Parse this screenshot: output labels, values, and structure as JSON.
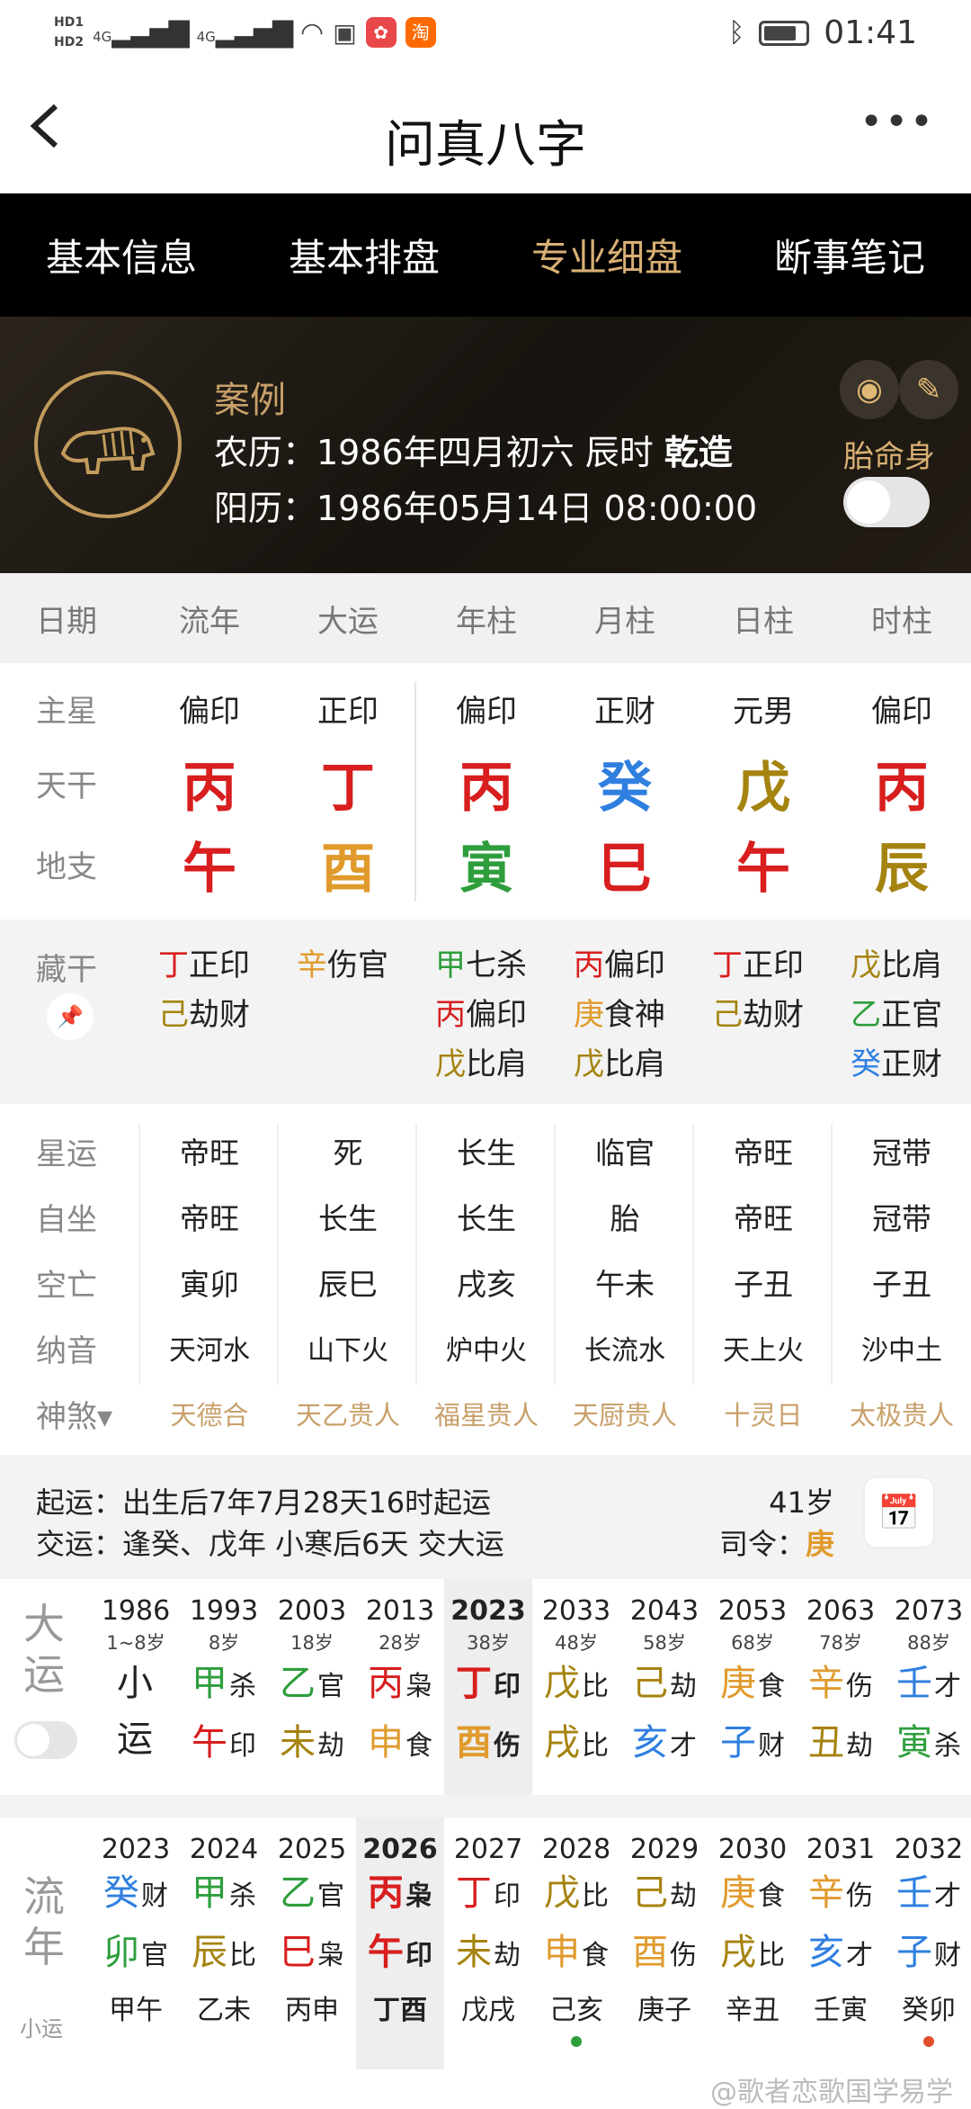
{
  "status": {
    "hd1": "HD1",
    "hd2": "HD2",
    "net1": "4G",
    "net2": "4G",
    "app1": "huawei",
    "app2": "淘",
    "time": "01:41"
  },
  "title": "问真八字",
  "tabs": [
    "基本信息",
    "基本排盘",
    "专业细盘",
    "断事笔记"
  ],
  "active_tab": 2,
  "profile": {
    "name": "案例",
    "lunar": "农历：1986年四月初六 辰时 ",
    "gender": "乾造",
    "solar": "阳历：1986年05月14日 08:00:00",
    "taiming": "胎命身"
  },
  "head": [
    "日期",
    "流年",
    "大运",
    "年柱",
    "月柱",
    "日柱",
    "时柱"
  ],
  "pillars": {
    "labels": [
      "主星",
      "天干",
      "地支"
    ],
    "stars": [
      "偏印",
      "正印",
      "偏印",
      "正财",
      "元男",
      "偏印"
    ],
    "gan": [
      {
        "c": "丙",
        "color": "#d81e1e"
      },
      {
        "c": "丁",
        "color": "#d81e1e"
      },
      {
        "c": "丙",
        "color": "#d81e1e"
      },
      {
        "c": "癸",
        "color": "#2f7fe0"
      },
      {
        "c": "戊",
        "color": "#a5830f"
      },
      {
        "c": "丙",
        "color": "#d81e1e"
      }
    ],
    "zhi": [
      {
        "c": "午",
        "color": "#d81e1e"
      },
      {
        "c": "酉",
        "color": "#e09a2c"
      },
      {
        "c": "寅",
        "color": "#2e9e3c"
      },
      {
        "c": "巳",
        "color": "#d81e1e"
      },
      {
        "c": "午",
        "color": "#d81e1e"
      },
      {
        "c": "辰",
        "color": "#a5830f"
      }
    ]
  },
  "hidden": {
    "label": "藏干",
    "cols": [
      [
        {
          "g": "丁",
          "c": "#d81e1e",
          "t": "正印"
        },
        {
          "g": "己",
          "c": "#a5830f",
          "t": "劫财"
        }
      ],
      [
        {
          "g": "辛",
          "c": "#e09a2c",
          "t": "伤官"
        }
      ],
      [
        {
          "g": "甲",
          "c": "#2e9e3c",
          "t": "七杀"
        },
        {
          "g": "丙",
          "c": "#d81e1e",
          "t": "偏印"
        },
        {
          "g": "戊",
          "c": "#a5830f",
          "t": "比肩"
        }
      ],
      [
        {
          "g": "丙",
          "c": "#d81e1e",
          "t": "偏印"
        },
        {
          "g": "庚",
          "c": "#e09a2c",
          "t": "食神"
        },
        {
          "g": "戊",
          "c": "#a5830f",
          "t": "比肩"
        }
      ],
      [
        {
          "g": "丁",
          "c": "#d81e1e",
          "t": "正印"
        },
        {
          "g": "己",
          "c": "#a5830f",
          "t": "劫财"
        }
      ],
      [
        {
          "g": "戊",
          "c": "#a5830f",
          "t": "比肩"
        },
        {
          "g": "乙",
          "c": "#2e9e3c",
          "t": "正官"
        },
        {
          "g": "癸",
          "c": "#2f7fe0",
          "t": "正财"
        }
      ]
    ]
  },
  "props": [
    {
      "label": "星运",
      "vals": [
        "帝旺",
        "死",
        "长生",
        "临官",
        "帝旺",
        "冠带"
      ]
    },
    {
      "label": "自坐",
      "vals": [
        "帝旺",
        "长生",
        "长生",
        "胎",
        "帝旺",
        "冠带"
      ]
    },
    {
      "label": "空亡",
      "vals": [
        "寅卯",
        "辰巳",
        "戌亥",
        "午未",
        "子丑",
        "子丑"
      ]
    },
    {
      "label": "纳音",
      "vals": [
        "天河水",
        "山下火",
        "炉中火",
        "长流水",
        "天上火",
        "沙中土"
      ]
    },
    {
      "label": "神煞▾",
      "vals": [
        "天德合",
        "天乙贵人",
        "福星贵人",
        "天厨贵人",
        "十灵日",
        "太极贵人"
      ]
    }
  ],
  "qiyun": {
    "line1": "起运：出生后7年7月28天16时起运",
    "line2": "交运：逢癸、戊年 小寒后6天 交大运",
    "age": "41岁",
    "siling_label": "司令：",
    "siling_val": "庚"
  },
  "dayun": {
    "label": "大运",
    "cols": [
      {
        "yr": "1986",
        "age": "1~8岁",
        "g": "小",
        "gc": "#222",
        "gt": "",
        "z": "运",
        "zc": "#222",
        "zt": ""
      },
      {
        "yr": "1993",
        "age": "8岁",
        "g": "甲",
        "gc": "#2e9e3c",
        "gt": "杀",
        "z": "午",
        "zc": "#d81e1e",
        "zt": "印"
      },
      {
        "yr": "2003",
        "age": "18岁",
        "g": "乙",
        "gc": "#2e9e3c",
        "gt": "官",
        "z": "未",
        "zc": "#a5830f",
        "zt": "劫"
      },
      {
        "yr": "2013",
        "age": "28岁",
        "g": "丙",
        "gc": "#d81e1e",
        "gt": "枭",
        "z": "申",
        "zc": "#e09a2c",
        "zt": "食"
      },
      {
        "yr": "2023",
        "age": "38岁",
        "g": "丁",
        "gc": "#d81e1e",
        "gt": "印",
        "z": "酉",
        "zc": "#e09a2c",
        "zt": "伤",
        "sel": true
      },
      {
        "yr": "2033",
        "age": "48岁",
        "g": "戊",
        "gc": "#a5830f",
        "gt": "比",
        "z": "戌",
        "zc": "#a5830f",
        "zt": "比"
      },
      {
        "yr": "2043",
        "age": "58岁",
        "g": "己",
        "gc": "#a5830f",
        "gt": "劫",
        "z": "亥",
        "zc": "#2f7fe0",
        "zt": "才"
      },
      {
        "yr": "2053",
        "age": "68岁",
        "g": "庚",
        "gc": "#e09a2c",
        "gt": "食",
        "z": "子",
        "zc": "#2f7fe0",
        "zt": "财"
      },
      {
        "yr": "2063",
        "age": "78岁",
        "g": "辛",
        "gc": "#e09a2c",
        "gt": "伤",
        "z": "丑",
        "zc": "#a5830f",
        "zt": "劫"
      },
      {
        "yr": "2073",
        "age": "88岁",
        "g": "壬",
        "gc": "#2f7fe0",
        "gt": "才",
        "z": "寅",
        "zc": "#2e9e3c",
        "zt": "杀"
      }
    ]
  },
  "liunian": {
    "label": "流年",
    "xiaoyun": "小运",
    "cols": [
      {
        "yr": "2023",
        "g": "癸",
        "gc": "#2f7fe0",
        "gt": "财",
        "z": "卯",
        "zc": "#2e9e3c",
        "zt": "官",
        "xy": "甲午"
      },
      {
        "yr": "2024",
        "g": "甲",
        "gc": "#2e9e3c",
        "gt": "杀",
        "z": "辰",
        "zc": "#a5830f",
        "zt": "比",
        "xy": "乙未"
      },
      {
        "yr": "2025",
        "g": "乙",
        "gc": "#2e9e3c",
        "gt": "官",
        "z": "巳",
        "zc": "#d81e1e",
        "zt": "枭",
        "xy": "丙申"
      },
      {
        "yr": "2026",
        "g": "丙",
        "gc": "#d81e1e",
        "gt": "枭",
        "z": "午",
        "zc": "#d81e1e",
        "zt": "印",
        "xy": "丁酉",
        "sel": true
      },
      {
        "yr": "2027",
        "g": "丁",
        "gc": "#d81e1e",
        "gt": "印",
        "z": "未",
        "zc": "#a5830f",
        "zt": "劫",
        "xy": "戊戌"
      },
      {
        "yr": "2028",
        "g": "戊",
        "gc": "#a5830f",
        "gt": "比",
        "z": "申",
        "zc": "#e09a2c",
        "zt": "食",
        "xy": "己亥",
        "dot": "#2e9e3c"
      },
      {
        "yr": "2029",
        "g": "己",
        "gc": "#a5830f",
        "gt": "劫",
        "z": "酉",
        "zc": "#e09a2c",
        "zt": "伤",
        "xy": "庚子"
      },
      {
        "yr": "2030",
        "g": "庚",
        "gc": "#e09a2c",
        "gt": "食",
        "z": "戌",
        "zc": "#a5830f",
        "zt": "比",
        "xy": "辛丑"
      },
      {
        "yr": "2031",
        "g": "辛",
        "gc": "#e09a2c",
        "gt": "伤",
        "z": "亥",
        "zc": "#2f7fe0",
        "zt": "才",
        "xy": "壬寅"
      },
      {
        "yr": "2032",
        "g": "壬",
        "gc": "#2f7fe0",
        "gt": "才",
        "z": "子",
        "zc": "#2f7fe0",
        "zt": "财",
        "xy": "癸卯",
        "dot": "#e0502c"
      }
    ]
  },
  "watermark": "@歌者恋歌国学易学"
}
